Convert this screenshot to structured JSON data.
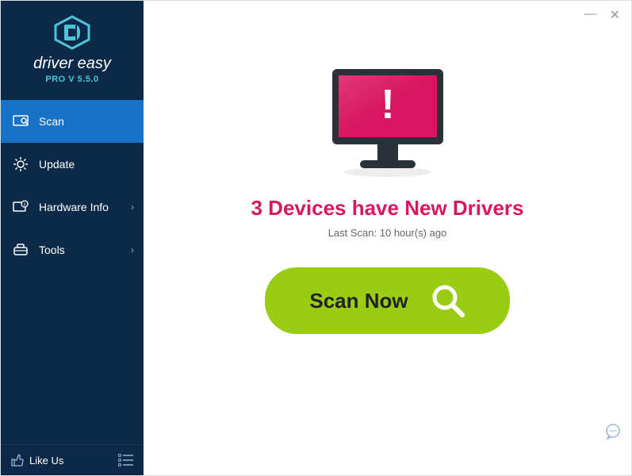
{
  "app": {
    "name": "driver easy",
    "version_label": "PRO V 5.5.0"
  },
  "nav": {
    "scan": "Scan",
    "update": "Update",
    "hardware": "Hardware Info",
    "tools": "Tools"
  },
  "bottom": {
    "like": "Like Us"
  },
  "main": {
    "headline": "3 Devices have New Drivers",
    "last_scan": "Last Scan: 10 hour(s) ago",
    "scan_button": "Scan Now"
  },
  "colors": {
    "accent": "#d91661",
    "scan_button": "#9acc14",
    "active_nav": "#1873c6"
  }
}
